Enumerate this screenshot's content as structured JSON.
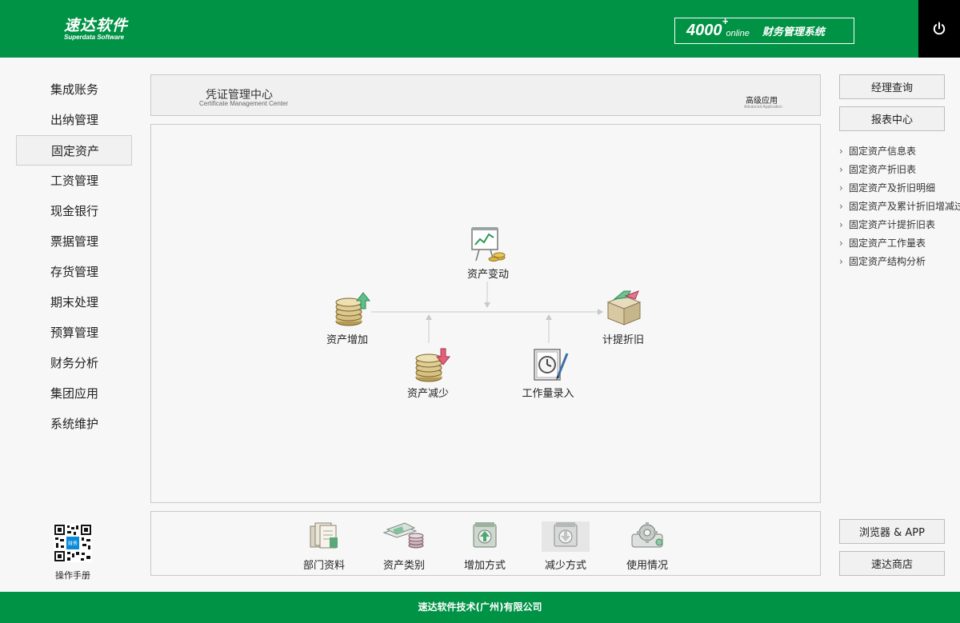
{
  "header": {
    "logo_main": "速达软件",
    "logo_sub": "Superdata Software",
    "sys_number": "4000",
    "sys_plus": "+",
    "sys_online": "online",
    "sys_name": "财务管理系统",
    "power_icon": "power-icon"
  },
  "leftnav": {
    "items": [
      {
        "label": "集成账务"
      },
      {
        "label": "出纳管理"
      },
      {
        "label": "固定资产",
        "active": true
      },
      {
        "label": "工资管理"
      },
      {
        "label": "现金银行"
      },
      {
        "label": "票据管理"
      },
      {
        "label": "存货管理"
      },
      {
        "label": "期末处理"
      },
      {
        "label": "预算管理"
      },
      {
        "label": "财务分析"
      },
      {
        "label": "集团应用"
      },
      {
        "label": "系统维护"
      }
    ],
    "qr_badge": "财务",
    "manual_label": "操作手册"
  },
  "title_panel": {
    "title": "凭证管理中心",
    "subtitle": "Certificate Management Center",
    "advanced": "高级应用",
    "advanced_sub": "Advanced Application"
  },
  "flow": {
    "asset_change": "资产变动",
    "asset_add": "资产增加",
    "asset_reduce": "资产减少",
    "workload_entry": "工作量录入",
    "depreciation": "计提折旧"
  },
  "bottom": {
    "items": [
      {
        "label": "部门资料",
        "icon": "department-icon"
      },
      {
        "label": "资产类别",
        "icon": "asset-category-icon"
      },
      {
        "label": "增加方式",
        "icon": "add-method-icon"
      },
      {
        "label": "减少方式",
        "icon": "reduce-method-icon"
      },
      {
        "label": "使用情况",
        "icon": "usage-icon"
      }
    ]
  },
  "right": {
    "manager_query": "经理查询",
    "report_center": "报表中心",
    "links": [
      "固定资产信息表",
      "固定资产折旧表",
      "固定资产及折旧明细",
      "固定资产及累计折旧增减过程",
      "固定资产计提折旧表",
      "固定资产工作量表",
      "固定资产结构分析"
    ],
    "browser_app": "浏览器 & APP",
    "store": "速达商店"
  },
  "footer": {
    "company": "速达软件技术(广州)有限公司"
  },
  "colors": {
    "brand_green": "#009245",
    "power_bg": "#000000"
  }
}
